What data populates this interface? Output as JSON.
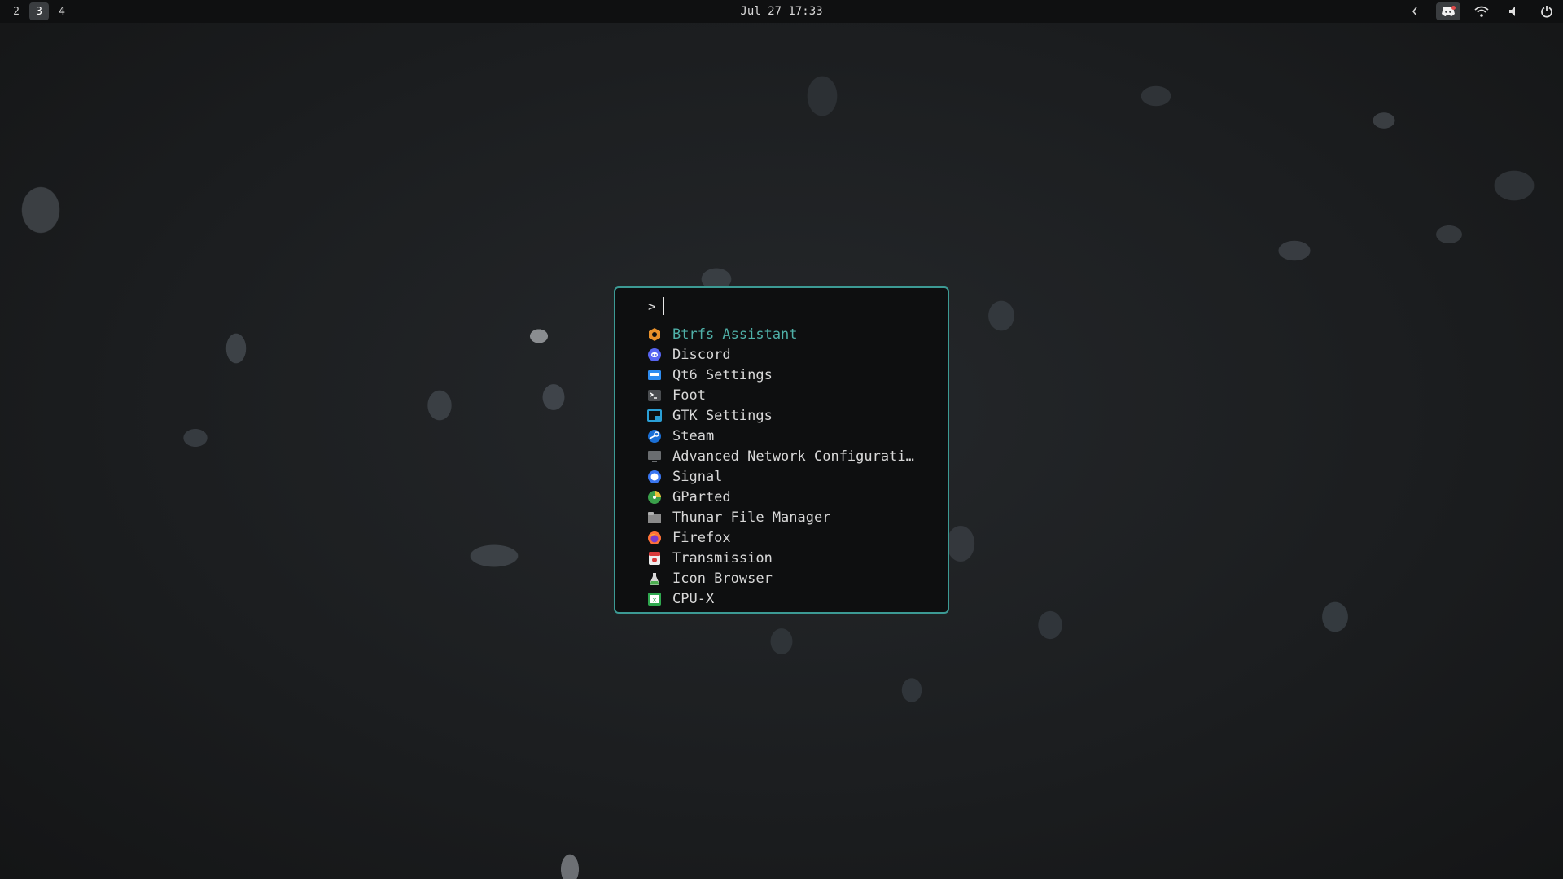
{
  "topbar": {
    "workspaces": [
      {
        "label": "2",
        "active": false
      },
      {
        "label": "3",
        "active": true
      },
      {
        "label": "4",
        "active": false
      }
    ],
    "clock": "Jul 27 17:33",
    "tray": [
      "chevron-left-icon",
      "discord-tray-icon",
      "wifi-icon",
      "volume-icon",
      "power-icon"
    ]
  },
  "launcher": {
    "prompt": ">",
    "query": "",
    "accent_color": "#3c9a94",
    "items": [
      {
        "label": "Btrfs Assistant",
        "icon": "btrfs-assistant-icon",
        "color": "#e8902a",
        "selected": true
      },
      {
        "label": "Discord",
        "icon": "discord-icon",
        "color": "#5865f2"
      },
      {
        "label": "Qt6 Settings",
        "icon": "qt6-settings-icon",
        "color": "#2e8cf0"
      },
      {
        "label": "Foot",
        "icon": "foot-terminal-icon",
        "color": "#4a4d50"
      },
      {
        "label": "GTK Settings",
        "icon": "gtk-settings-icon",
        "color": "#2a9fd6"
      },
      {
        "label": "Steam",
        "icon": "steam-icon",
        "color": "#1a6fd6"
      },
      {
        "label": "Advanced Network Configurati…",
        "icon": "network-config-icon",
        "color": "#6a6d70"
      },
      {
        "label": "Signal",
        "icon": "signal-icon",
        "color": "#3a76f0"
      },
      {
        "label": "GParted",
        "icon": "gparted-icon",
        "color": "#3aa04a"
      },
      {
        "label": "Thunar File Manager",
        "icon": "thunar-icon",
        "color": "#8a8a8a"
      },
      {
        "label": "Firefox",
        "icon": "firefox-icon",
        "color": "#ff7139"
      },
      {
        "label": "Transmission",
        "icon": "transmission-icon",
        "color": "#d83a3a"
      },
      {
        "label": "Icon Browser",
        "icon": "icon-browser-icon",
        "color": "#4caf50"
      },
      {
        "label": "CPU-X",
        "icon": "cpu-x-icon",
        "color": "#2fa84f"
      }
    ]
  }
}
